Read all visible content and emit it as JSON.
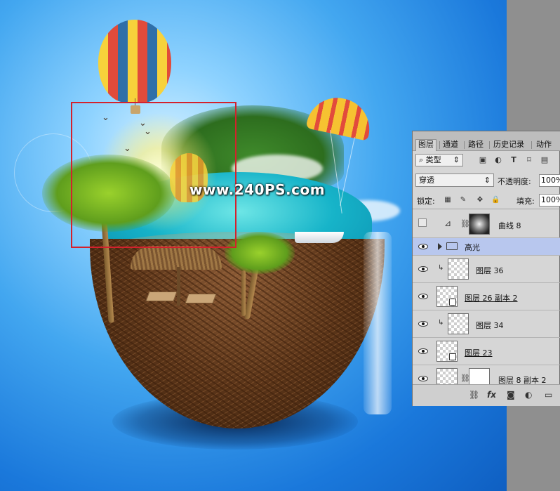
{
  "watermark": "www.240PS.com",
  "layers_panel": {
    "tabs": [
      "图层",
      "通道",
      "路径",
      "历史记录",
      "动作"
    ],
    "filter": {
      "kind_label": "类型"
    },
    "blend_mode": "穿透",
    "opacity": {
      "label": "不透明度:",
      "value": "100%"
    },
    "lock": {
      "label": "锁定:"
    },
    "fill": {
      "label": "填充:",
      "value": "100%"
    },
    "layers": [
      {
        "name": "曲线 8",
        "type": "adjustment-curves",
        "visible": false
      },
      {
        "name": "高光",
        "type": "group",
        "visible": true,
        "selected": true
      },
      {
        "name": "图层 36",
        "type": "pixel",
        "visible": true,
        "clipped": true
      },
      {
        "name": "图层 26 副本 2",
        "type": "smart",
        "visible": true
      },
      {
        "name": "图层 34",
        "type": "pixel",
        "visible": true,
        "clipped": true
      },
      {
        "name": "图层 23",
        "type": "smart",
        "visible": true
      },
      {
        "name": "图层 8 副本 2",
        "type": "masked",
        "visible": true
      }
    ],
    "bottom_icons": [
      "link-icon",
      "fx-icon",
      "add-mask-icon",
      "adjustment-icon",
      "folder-icon"
    ],
    "bottom_fx": "fx"
  }
}
